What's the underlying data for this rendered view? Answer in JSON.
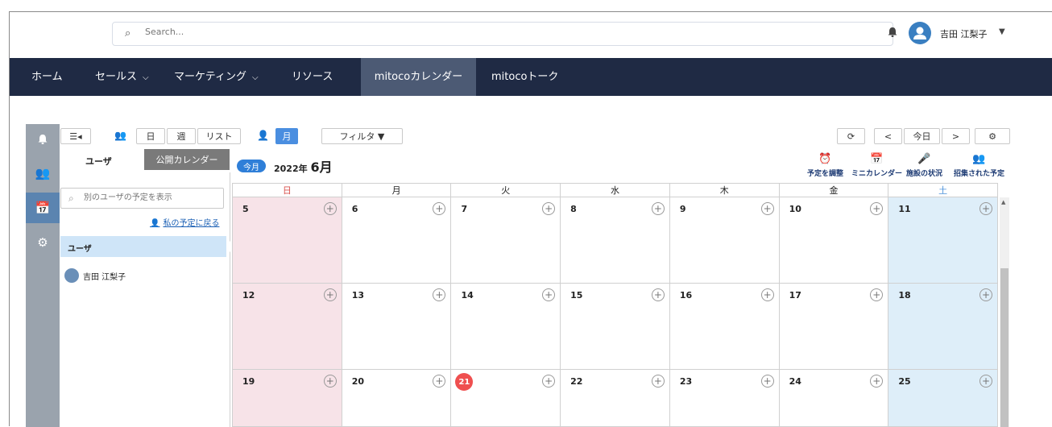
{
  "header": {
    "search_placeholder": "Search...",
    "user_name": "吉田 江梨子"
  },
  "nav": {
    "items": [
      {
        "label": "ホーム",
        "dropdown": false
      },
      {
        "label": "セールス",
        "dropdown": true
      },
      {
        "label": "マーケティング",
        "dropdown": true
      },
      {
        "label": "リソース",
        "dropdown": false
      },
      {
        "label": "mitocoカレンダー",
        "dropdown": false,
        "active": true
      },
      {
        "label": "mitocoトーク",
        "dropdown": false
      }
    ]
  },
  "toolbar": {
    "day": "日",
    "week": "週",
    "list": "リスト",
    "month": "月",
    "filter": "フィルタ ▼",
    "prev": "<",
    "today": "今日",
    "next": ">"
  },
  "panel": {
    "tab_user": "ユーザ",
    "tab_public": "公開カレンダー",
    "user_search_placeholder": "別のユーザの予定を表示",
    "back_link": "私の予定に戻る",
    "user_header": "ユーザ",
    "users": [
      "吉田 江梨子"
    ]
  },
  "calendar": {
    "today_pill": "今月",
    "year": "2022年",
    "month": "6月",
    "tools": [
      "予定を調整",
      "ミニカレンダー",
      "施設の状況",
      "招集された予定"
    ],
    "weekdays": [
      "日",
      "月",
      "火",
      "水",
      "木",
      "金",
      "土"
    ],
    "weeks": [
      [
        "5",
        "6",
        "7",
        "8",
        "9",
        "10",
        "11"
      ],
      [
        "12",
        "13",
        "14",
        "15",
        "16",
        "17",
        "18"
      ],
      [
        "19",
        "20",
        "21",
        "22",
        "23",
        "24",
        "25"
      ]
    ],
    "today_date": "21"
  },
  "colors": {
    "nav_bg": "#1f2a44",
    "nav_active": "#4c5a74",
    "accent_blue": "#4a8ee0",
    "sunday_bg": "#f7e3e8",
    "saturday_bg": "#deeef9",
    "today_red": "#ef4f4f"
  }
}
